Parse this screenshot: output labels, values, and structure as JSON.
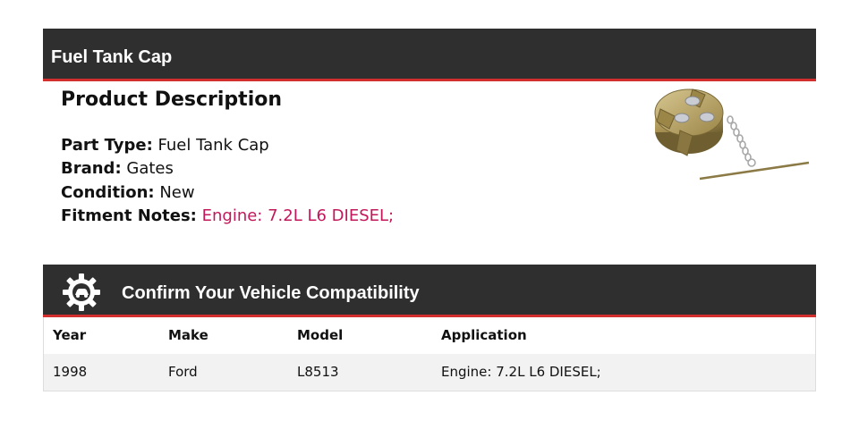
{
  "product": {
    "title": "Fuel Tank Cap"
  },
  "description": {
    "heading": "Product Description",
    "fields": [
      {
        "label": "Part Type:",
        "value": "Fuel Tank Cap"
      },
      {
        "label": "Brand:",
        "value": "Gates"
      },
      {
        "label": "Condition:",
        "value": "New"
      },
      {
        "label": "Fitment Notes:",
        "value": "Engine: 7.2L L6 DIESEL;"
      }
    ],
    "accent_color": "#c2185b"
  },
  "compatibility": {
    "title": "Confirm Your Vehicle Compatibility",
    "icon": "gear-car-icon",
    "columns": [
      "Year",
      "Make",
      "Model",
      "Application"
    ],
    "rows": [
      [
        "1998",
        "Ford",
        "L8513",
        "Engine: 7.2L L6 DIESEL;"
      ]
    ]
  },
  "colors": {
    "header_bg": "#2f2f2f",
    "header_border": "#d32f2f",
    "row_bg": "#f2f2f2"
  }
}
